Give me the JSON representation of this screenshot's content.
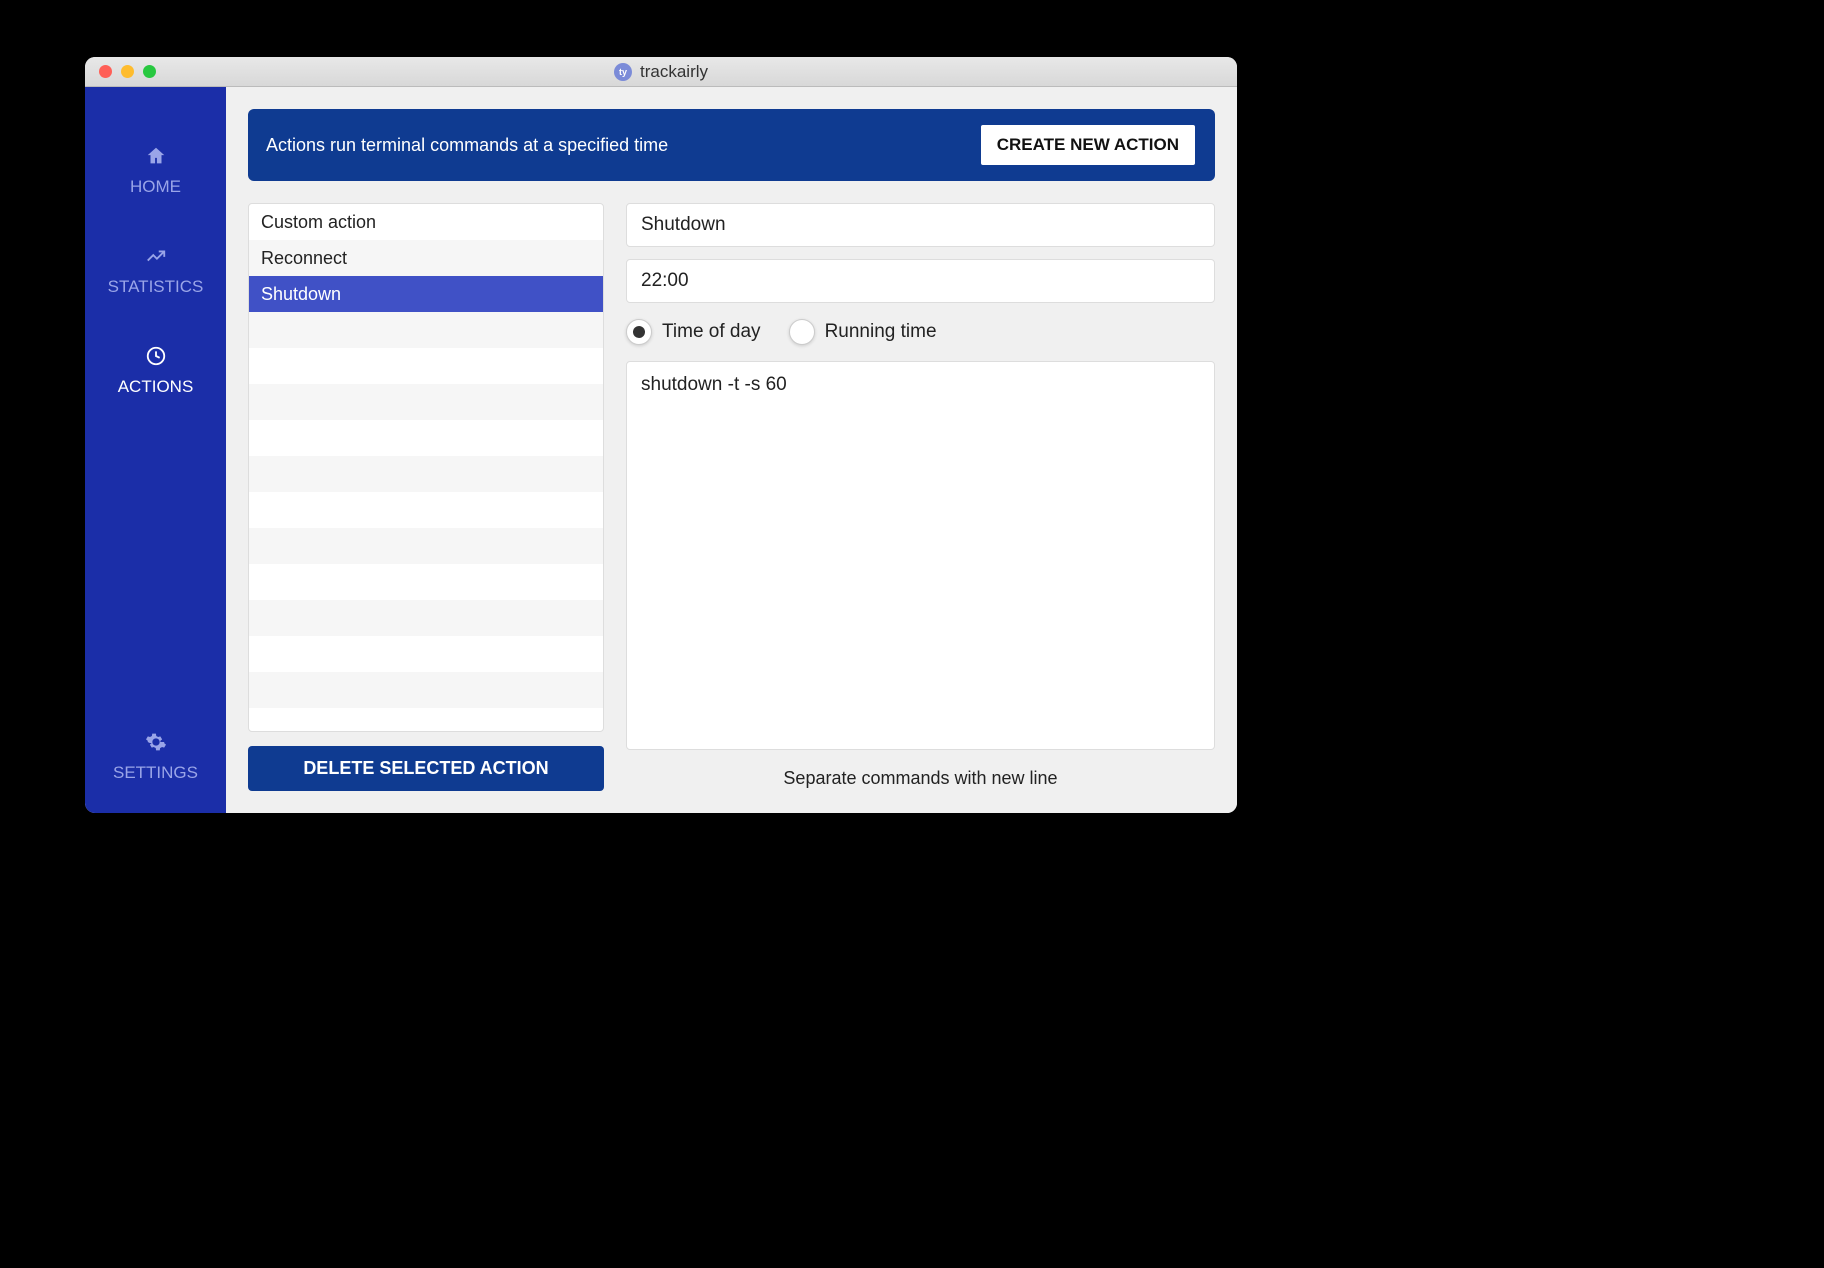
{
  "window": {
    "app_title": "trackairly",
    "app_icon_text": "ty"
  },
  "sidebar": {
    "items": [
      {
        "label": "HOME",
        "icon": "home-icon",
        "active": false
      },
      {
        "label": "STATISTICS",
        "icon": "chart-icon",
        "active": false
      },
      {
        "label": "ACTIONS",
        "icon": "clock-icon",
        "active": true
      },
      {
        "label": "SETTINGS",
        "icon": "gear-icon",
        "active": false
      }
    ]
  },
  "banner": {
    "text": "Actions run terminal commands at a specified time",
    "create_label": "CREATE NEW ACTION"
  },
  "actions_list": {
    "items": [
      {
        "label": "Custom action",
        "selected": false
      },
      {
        "label": "Reconnect",
        "selected": false
      },
      {
        "label": "Shutdown",
        "selected": true
      }
    ],
    "blank_rows": 12,
    "delete_label": "DELETE SELECTED ACTION"
  },
  "form": {
    "name_value": "Shutdown",
    "time_value": "22:00",
    "radio": {
      "time_of_day_label": "Time of day",
      "running_time_label": "Running time",
      "selected": "time_of_day"
    },
    "command_value": "shutdown -t -s 60",
    "hint": "Separate commands with new line"
  },
  "colors": {
    "sidebar_bg": "#1b2ea8",
    "banner_bg": "#0f3b91",
    "selected_row": "#4051c6"
  }
}
